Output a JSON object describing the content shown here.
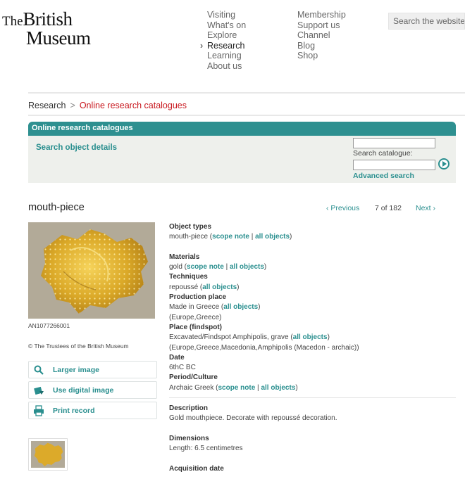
{
  "logo": {
    "line1_small": "The",
    "line1_big": "British",
    "line2": "Museum"
  },
  "nav": {
    "col1": [
      "Visiting",
      "What's on",
      "Explore",
      "Research",
      "Learning",
      "About us"
    ],
    "col2": [
      "Membership",
      "Support us",
      "Channel",
      "Blog",
      "Shop"
    ],
    "active": "Research"
  },
  "search_site": {
    "placeholder": "Search the website"
  },
  "breadcrumb": {
    "home": "Research",
    "separator": ">",
    "current": "Online research catalogues"
  },
  "catalogue_panel": {
    "heading": "Online research catalogues",
    "search_object_details": "Search object details",
    "search_catalogue_label": "Search catalogue:",
    "advanced_search": "Advanced search"
  },
  "object": {
    "title": "mouth-piece",
    "image_id": "AN1077266001",
    "copyright": "© The Trustees of the British Museum"
  },
  "pager": {
    "prev": "‹ Previous",
    "position": "7 of 182",
    "next": "Next ›"
  },
  "actions": {
    "larger_image": "Larger image",
    "digital_image": "Use digital image",
    "print_record": "Print record"
  },
  "details": {
    "object_types_label": "Object types",
    "object_types_value": "mouth-piece",
    "materials_label": "Materials",
    "materials_value": "gold",
    "techniques_label": "Techniques",
    "techniques_value": "repoussé",
    "production_place_label": "Production place",
    "production_place_value": "Made in Greece",
    "production_place_region": "(Europe,Greece)",
    "findspot_label": "Place (findspot)",
    "findspot_value": "Excavated/Findspot Amphipolis, grave",
    "findspot_region": "(Europe,Greece,Macedonia,Amphipolis (Macedon - archaic))",
    "date_label": "Date",
    "date_value": "6thC BC",
    "period_label": "Period/Culture",
    "period_value": "Archaic Greek",
    "description_label": "Description",
    "description_value": "Gold mouthpiece. Decorate with repoussé decoration.",
    "dimensions_label": "Dimensions",
    "dimensions_value": "Length: 6.5 centimetres",
    "acquisition_label": "Acquisition date"
  },
  "links": {
    "scope_note": "scope note",
    "all_objects": "all objects",
    "divider": "|"
  },
  "colors": {
    "accent": "#2a8f8f",
    "panel_head": "#2e9090",
    "breadcrumb_current": "#c8171e",
    "panel_bg": "#eef0ec"
  }
}
